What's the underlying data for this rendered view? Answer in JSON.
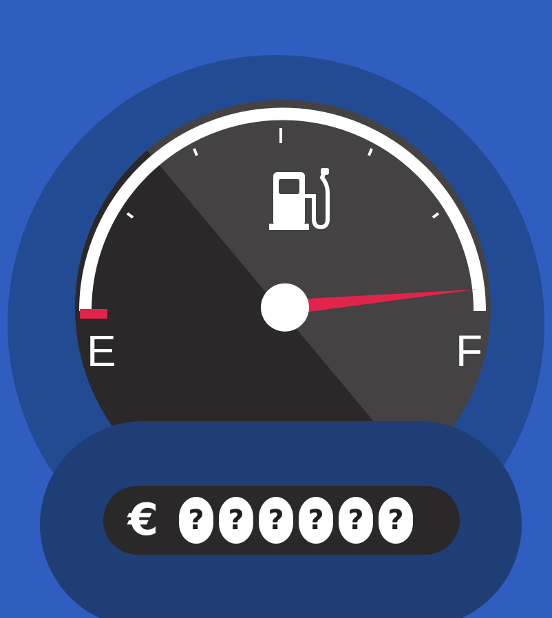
{
  "gauge": {
    "empty_label": "E",
    "full_label": "F",
    "level": 0.97,
    "colors": {
      "background": "#2f5ec0",
      "halo": "#234b93",
      "dial_light": "#454243",
      "dial_dark": "#2a2828",
      "needle": "#e0244a",
      "arc": "#ffffff"
    },
    "icon": "fuel-pump-icon"
  },
  "counter": {
    "currency_symbol": "€",
    "digits": [
      "?",
      "?",
      "?",
      "?",
      "?",
      "?"
    ]
  }
}
